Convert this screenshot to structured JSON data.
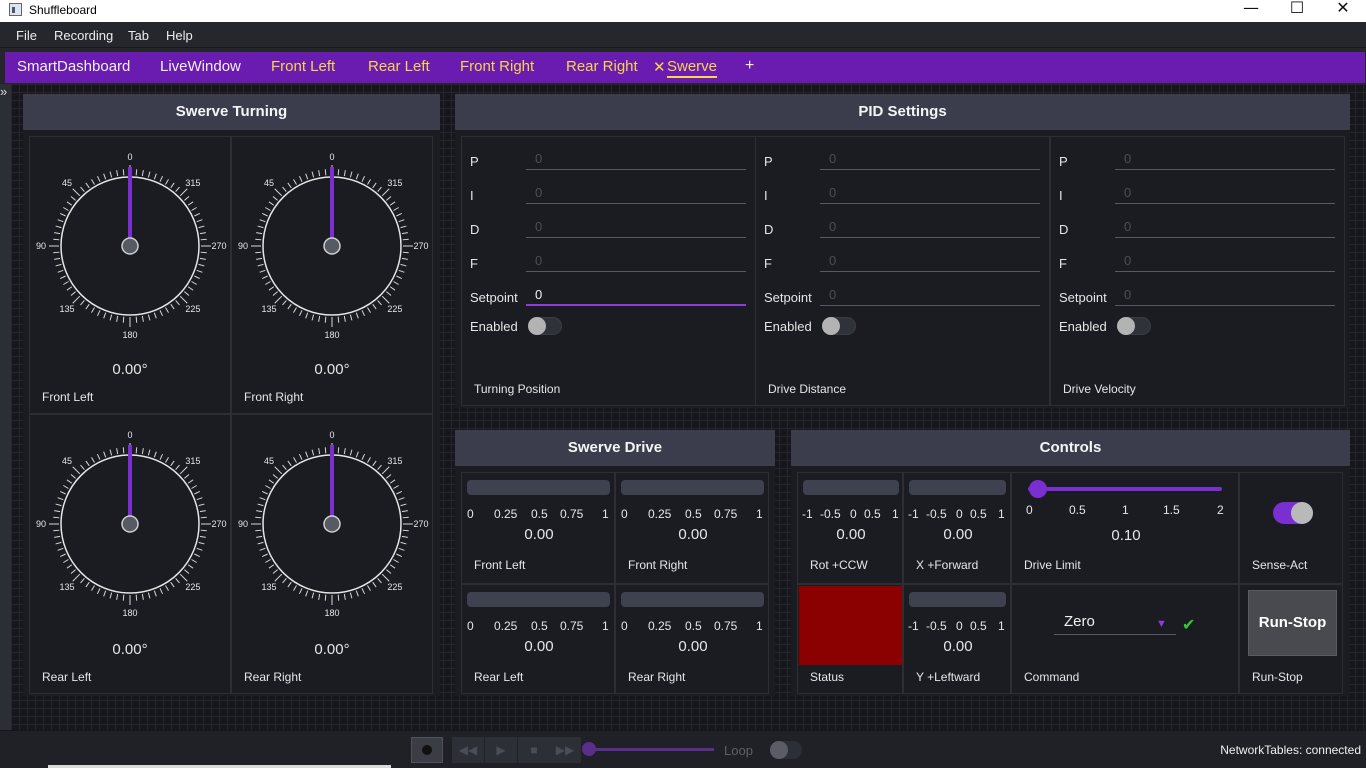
{
  "window": {
    "title": "Shuffleboard",
    "minimize": "—",
    "maximize": "☐",
    "close": "✕"
  },
  "menu": [
    "File",
    "Recording",
    "Tab",
    "Help"
  ],
  "tabs": [
    "SmartDashboard",
    "LiveWindow",
    "Front Left",
    "Rear Left",
    "Front Right",
    "Rear Right",
    "Swerve"
  ],
  "tab_close": "✕",
  "tab_add": "+",
  "left_strip_icon": "»",
  "swerve_turning": {
    "title": "Swerve Turning",
    "dial_ticks": [
      "0",
      "45",
      "90",
      "135",
      "180",
      "225",
      "270",
      "315"
    ],
    "gyros": [
      {
        "label": "Front Left",
        "value": "0.00°",
        "angle_deg": 0
      },
      {
        "label": "Front Right",
        "value": "0.00°",
        "angle_deg": 0
      },
      {
        "label": "Rear Left",
        "value": "0.00°",
        "angle_deg": 0
      },
      {
        "label": "Rear Right",
        "value": "0.00°",
        "angle_deg": 0
      }
    ]
  },
  "pid_settings": {
    "title": "PID Settings",
    "row_labels": [
      "P",
      "I",
      "D",
      "F",
      "Setpoint"
    ],
    "enabled_label": "Enabled",
    "controllers": [
      {
        "label": "Turning Position",
        "values": [
          "0",
          "0",
          "0",
          "0",
          "0"
        ],
        "enabled": false
      },
      {
        "label": "Drive Distance",
        "values": [
          "0",
          "0",
          "0",
          "0",
          "0"
        ],
        "enabled": false
      },
      {
        "label": "Drive Velocity",
        "values": [
          "0",
          "0",
          "0",
          "0",
          "0"
        ],
        "enabled": false
      }
    ]
  },
  "swerve_drive": {
    "title": "Swerve Drive",
    "ticks": [
      "0",
      "0.25",
      "0.5",
      "0.75",
      "1"
    ],
    "bars": [
      {
        "label": "Front Left",
        "value": "0.00"
      },
      {
        "label": "Front Right",
        "value": "0.00"
      },
      {
        "label": "Rear Left",
        "value": "0.00"
      },
      {
        "label": "Rear Right",
        "value": "0.00"
      }
    ]
  },
  "controls": {
    "title": "Controls",
    "axis_ticks": [
      "-1",
      "-0.5",
      "0",
      "0.5",
      "1"
    ],
    "rot": {
      "label": "Rot +CCW",
      "value": "0.00"
    },
    "x": {
      "label": "X +Forward",
      "value": "0.00"
    },
    "y": {
      "label": "Y +Leftward",
      "value": "0.00"
    },
    "drive_limit": {
      "label": "Drive Limit",
      "value": "0.10",
      "ticks": [
        "0",
        "0.5",
        "1",
        "1.5",
        "2"
      ],
      "level": 0.05
    },
    "sense_act": {
      "label": "Sense-Act",
      "on": true
    },
    "status": {
      "label": "Status",
      "color": "#8b0000"
    },
    "command": {
      "label": "Command",
      "selected": "Zero"
    },
    "runstop": {
      "label": "Run-Stop",
      "button": "Run-Stop"
    }
  },
  "bottom": {
    "loop_label": "Loop",
    "network_status": "NetworkTables: connected"
  },
  "colors": {
    "accent": "#7a2fd0",
    "tab_bar": "#6a1cb0",
    "tab_highlight": "#f7d54a",
    "status_error": "#8b0000",
    "header": "#3b3d4c"
  }
}
